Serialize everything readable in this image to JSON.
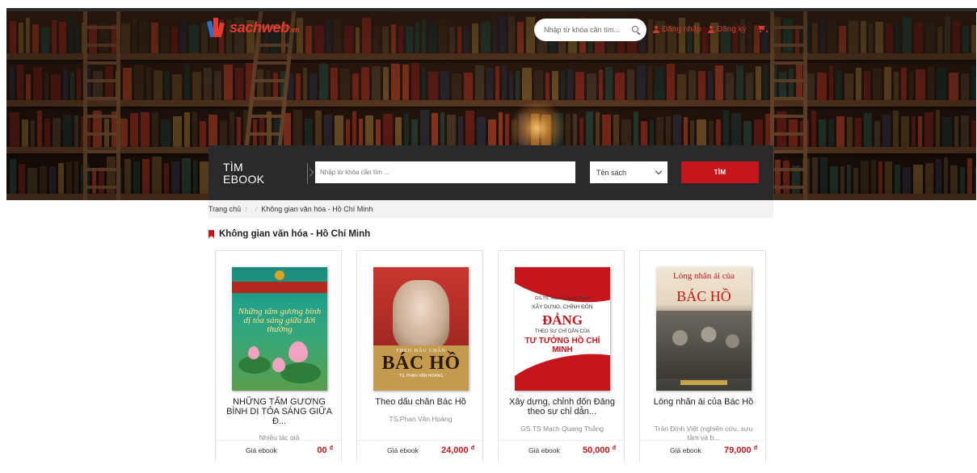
{
  "header": {
    "logo_text": "sachweb",
    "logo_suffix": ".vn",
    "search_placeholder": "Nhập từ khóa cần tìm...",
    "login_label": "Đăng nhập",
    "register_label": "Đăng ký"
  },
  "ebook_search": {
    "title_line1": "TÌM",
    "title_line2": "EBOOK",
    "input_placeholder": "Nhập từ khóa cần tìm ...",
    "select_value": "Tên sách",
    "button_label": "TÌM"
  },
  "breadcrumb": {
    "home": "Trang chủ",
    "separator": "/",
    "current": "Không gian văn hóa - Hồ Chí Minh"
  },
  "section": {
    "title": "Không gian văn hóa - Hồ Chí Minh"
  },
  "products": [
    {
      "title": "NHỮNG TẤM GƯƠNG BÌNH DỊ TỎA SÁNG GIỮA Đ...",
      "author": "Nhiều tác giả",
      "price_label": "Giá ebook",
      "price": "00",
      "currency": "đ",
      "cover_text": "Những tấm gương bình dị tỏa sáng giữa đời thường"
    },
    {
      "title": "Theo dấu chân Bác Hồ",
      "author": "TS.Phan Văn Hoàng",
      "price_label": "Giá ebook",
      "price": "24,000",
      "currency": "đ",
      "cover_sub": "THEO DẤU CHÂN",
      "cover_big": "BÁC HỒ",
      "cover_author": "TS. PHAN VĂN HOÀNG"
    },
    {
      "title": "Xây dựng, chỉnh đốn Đảng theo sự chỉ dẫn...",
      "author": "GS.TS Mạch Quang Thắng",
      "price_label": "Giá ebook",
      "price": "50,000",
      "currency": "đ",
      "cover_l1": "GS.TS. Mạch Quang Thắng",
      "cover_l2": "XÂY DỰNG, CHỈNH ĐỐN",
      "cover_l3": "ĐẢNG",
      "cover_l4": "THEO SỰ CHỈ DẪN CỦA",
      "cover_l5": "TƯ TƯỞNG HỒ CHÍ MINH"
    },
    {
      "title": "Lòng nhân ái của Bác Hồ",
      "author": "Trần Đình Việt (nghiên cứu, sưu tầm và b...",
      "price_label": "Giá ebook",
      "price": "79,000",
      "currency": "đ",
      "cover_t1": "Lòng nhân ái của",
      "cover_t2": "BÁC HỒ"
    }
  ],
  "colors": {
    "brand_red": "#c4161c",
    "panel_dark": "#2a2a2a",
    "breadcrumb_bg": "#f2f2f2"
  },
  "icons": [
    "search-icon",
    "user-icon",
    "cart-icon",
    "bookmark-icon",
    "chevron-down-icon"
  ]
}
